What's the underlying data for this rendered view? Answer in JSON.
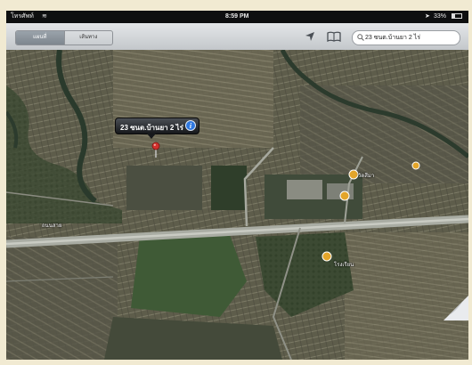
{
  "status_bar": {
    "carrier": "โทรศัพท์",
    "time": "8:59 PM",
    "battery": "33%"
  },
  "toolbar": {
    "segments": [
      "แผนที่",
      "เส้นทาง"
    ],
    "active_segment": 0,
    "search_value": "23 ซนต.บ้านยา 2 ไร่"
  },
  "map": {
    "mode": "satellite",
    "callout_title": "23 ซนต.บ้านยา 2 ไร่",
    "pin_color": "#d0312d",
    "labels": [
      "วัดสีมา",
      "โรงเรียน",
      "ถนนสาย"
    ]
  },
  "icons": {
    "location": "location-arrow-icon",
    "bookmarks": "bookmarks-icon",
    "search": "search-icon",
    "info": "info-icon",
    "pin": "map-pin-icon",
    "page_curl": "page-curl-icon"
  }
}
